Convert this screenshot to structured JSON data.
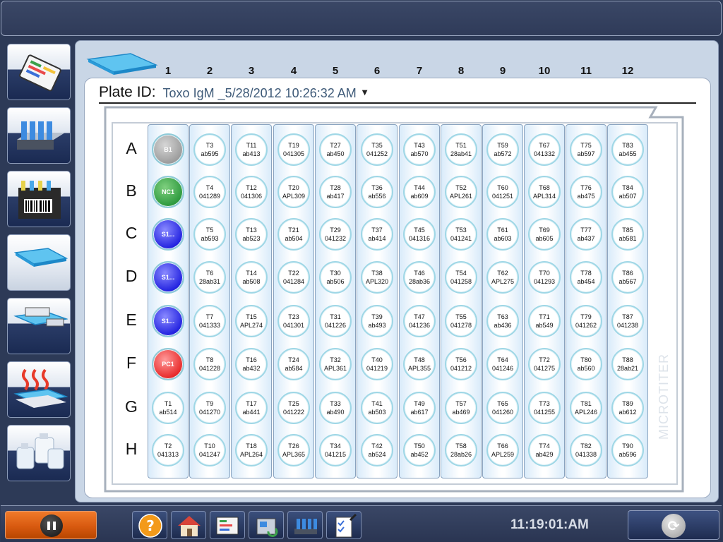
{
  "plate_id": {
    "label": "Plate ID:",
    "value": "Toxo IgM _5/28/2012 10:26:32 AM"
  },
  "columns": [
    "1",
    "2",
    "3",
    "4",
    "5",
    "6",
    "7",
    "8",
    "9",
    "10",
    "11",
    "12"
  ],
  "rows": [
    "A",
    "B",
    "C",
    "D",
    "E",
    "F",
    "G",
    "H"
  ],
  "plate_side_label": "MICROTITER",
  "wells": [
    [
      {
        "l1": "B1",
        "l2": "",
        "color": "gray"
      },
      {
        "l1": "NC1",
        "l2": "",
        "color": "green"
      },
      {
        "l1": "S1...",
        "l2": "",
        "color": "blue"
      },
      {
        "l1": "S1...",
        "l2": "",
        "color": "blue"
      },
      {
        "l1": "S1...",
        "l2": "",
        "color": "blue"
      },
      {
        "l1": "PC1",
        "l2": "",
        "color": "red"
      },
      {
        "l1": "T1",
        "l2": "ab514"
      },
      {
        "l1": "T2",
        "l2": "041313"
      }
    ],
    [
      {
        "l1": "T3",
        "l2": "ab595"
      },
      {
        "l1": "T4",
        "l2": "041289"
      },
      {
        "l1": "T5",
        "l2": "ab593"
      },
      {
        "l1": "T6",
        "l2": "28ab31"
      },
      {
        "l1": "T7",
        "l2": "041333"
      },
      {
        "l1": "T8",
        "l2": "041228"
      },
      {
        "l1": "T9",
        "l2": "041270"
      },
      {
        "l1": "T10",
        "l2": "041247"
      }
    ],
    [
      {
        "l1": "T11",
        "l2": "ab413"
      },
      {
        "l1": "T12",
        "l2": "041306"
      },
      {
        "l1": "T13",
        "l2": "ab523"
      },
      {
        "l1": "T14",
        "l2": "ab508"
      },
      {
        "l1": "T15",
        "l2": "APL274"
      },
      {
        "l1": "T16",
        "l2": "ab432"
      },
      {
        "l1": "T17",
        "l2": "ab441"
      },
      {
        "l1": "T18",
        "l2": "APL264"
      }
    ],
    [
      {
        "l1": "T19",
        "l2": "041305"
      },
      {
        "l1": "T20",
        "l2": "APL309"
      },
      {
        "l1": "T21",
        "l2": "ab504"
      },
      {
        "l1": "T22",
        "l2": "041284"
      },
      {
        "l1": "T23",
        "l2": "041301"
      },
      {
        "l1": "T24",
        "l2": "ab584"
      },
      {
        "l1": "T25",
        "l2": "041222"
      },
      {
        "l1": "T26",
        "l2": "APL365"
      }
    ],
    [
      {
        "l1": "T27",
        "l2": "ab450"
      },
      {
        "l1": "T28",
        "l2": "ab417"
      },
      {
        "l1": "T29",
        "l2": "041232"
      },
      {
        "l1": "T30",
        "l2": "ab506"
      },
      {
        "l1": "T31",
        "l2": "041226"
      },
      {
        "l1": "T32",
        "l2": "APL361"
      },
      {
        "l1": "T33",
        "l2": "ab490"
      },
      {
        "l1": "T34",
        "l2": "041215"
      }
    ],
    [
      {
        "l1": "T35",
        "l2": "041252"
      },
      {
        "l1": "T36",
        "l2": "ab556"
      },
      {
        "l1": "T37",
        "l2": "ab414"
      },
      {
        "l1": "T38",
        "l2": "APL320"
      },
      {
        "l1": "T39",
        "l2": "ab493"
      },
      {
        "l1": "T40",
        "l2": "041219"
      },
      {
        "l1": "T41",
        "l2": "ab503"
      },
      {
        "l1": "T42",
        "l2": "ab524"
      }
    ],
    [
      {
        "l1": "T43",
        "l2": "ab570"
      },
      {
        "l1": "T44",
        "l2": "ab609"
      },
      {
        "l1": "T45",
        "l2": "041316"
      },
      {
        "l1": "T46",
        "l2": "28ab36"
      },
      {
        "l1": "T47",
        "l2": "041236"
      },
      {
        "l1": "T48",
        "l2": "APL355"
      },
      {
        "l1": "T49",
        "l2": "ab617"
      },
      {
        "l1": "T50",
        "l2": "ab452"
      }
    ],
    [
      {
        "l1": "T51",
        "l2": "28ab41"
      },
      {
        "l1": "T52",
        "l2": "APL261"
      },
      {
        "l1": "T53",
        "l2": "041241"
      },
      {
        "l1": "T54",
        "l2": "041258"
      },
      {
        "l1": "T55",
        "l2": "041278"
      },
      {
        "l1": "T56",
        "l2": "041212"
      },
      {
        "l1": "T57",
        "l2": "ab469"
      },
      {
        "l1": "T58",
        "l2": "28ab26"
      }
    ],
    [
      {
        "l1": "T59",
        "l2": "ab572"
      },
      {
        "l1": "T60",
        "l2": "041251"
      },
      {
        "l1": "T61",
        "l2": "ab603"
      },
      {
        "l1": "T62",
        "l2": "APL275"
      },
      {
        "l1": "T63",
        "l2": "ab436"
      },
      {
        "l1": "T64",
        "l2": "041246"
      },
      {
        "l1": "T65",
        "l2": "041260"
      },
      {
        "l1": "T66",
        "l2": "APL259"
      }
    ],
    [
      {
        "l1": "T67",
        "l2": "041332"
      },
      {
        "l1": "T68",
        "l2": "APL314"
      },
      {
        "l1": "T69",
        "l2": "ab605"
      },
      {
        "l1": "T70",
        "l2": "041293"
      },
      {
        "l1": "T71",
        "l2": "ab549"
      },
      {
        "l1": "T72",
        "l2": "041275"
      },
      {
        "l1": "T73",
        "l2": "041255"
      },
      {
        "l1": "T74",
        "l2": "ab429"
      }
    ],
    [
      {
        "l1": "T75",
        "l2": "ab597"
      },
      {
        "l1": "T76",
        "l2": "ab475"
      },
      {
        "l1": "T77",
        "l2": "ab437"
      },
      {
        "l1": "T78",
        "l2": "ab454"
      },
      {
        "l1": "T79",
        "l2": "041262"
      },
      {
        "l1": "T80",
        "l2": "ab560"
      },
      {
        "l1": "T81",
        "l2": "APL246"
      },
      {
        "l1": "T82",
        "l2": "041338"
      }
    ],
    [
      {
        "l1": "T83",
        "l2": "ab455"
      },
      {
        "l1": "T84",
        "l2": "ab507"
      },
      {
        "l1": "T85",
        "l2": "ab581"
      },
      {
        "l1": "T86",
        "l2": "ab567"
      },
      {
        "l1": "T87",
        "l2": "041238"
      },
      {
        "l1": "T88",
        "l2": "28ab21"
      },
      {
        "l1": "T89",
        "l2": "ab612"
      },
      {
        "l1": "T90",
        "l2": "ab596"
      }
    ]
  ],
  "sidebar": {
    "items": [
      {
        "name": "sidebar-item-reports",
        "icon": "report-screen-icon"
      },
      {
        "name": "sidebar-item-tubes",
        "icon": "sample-tubes-icon"
      },
      {
        "name": "sidebar-item-barcode-rack",
        "icon": "barcode-rack-icon"
      },
      {
        "name": "sidebar-item-plate",
        "icon": "microplate-icon",
        "active": true
      },
      {
        "name": "sidebar-item-washer",
        "icon": "plate-washer-icon"
      },
      {
        "name": "sidebar-item-incubator",
        "icon": "incubator-heat-icon"
      },
      {
        "name": "sidebar-item-reagents",
        "icon": "reagent-bottles-icon"
      }
    ]
  },
  "toolbar": {
    "tools": [
      {
        "name": "help-button",
        "icon": "help-icon"
      },
      {
        "name": "home-button",
        "icon": "home-icon"
      },
      {
        "name": "report-button",
        "icon": "report-screen-icon"
      },
      {
        "name": "instrument-button",
        "icon": "instrument-icon"
      },
      {
        "name": "tube-rack-button",
        "icon": "tube-rack-icon"
      },
      {
        "name": "checklist-button",
        "icon": "checklist-icon"
      }
    ]
  },
  "clock": "11:19:01:AM",
  "colors": {
    "background": "#2d3a57",
    "panel": "#c9d6e6",
    "well_border": "#9fd7e6",
    "pause_button": "#d85a10",
    "blank_well": "#9c9c9c",
    "negative_control": "#2e9a3e",
    "standard": "#2323e0",
    "positive_control": "#e82a2a"
  }
}
